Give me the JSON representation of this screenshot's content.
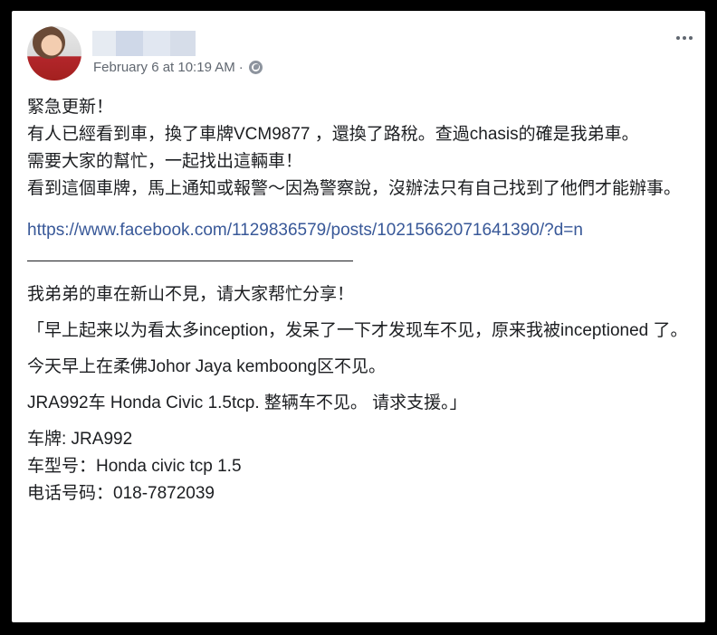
{
  "post": {
    "timestamp": "February 6 at 10:19 AM",
    "separator_dot": "·",
    "audience_icon": "globe-icon",
    "more_icon": "more-options-icon"
  },
  "content": {
    "update_lines": [
      "緊急更新！",
      "有人已經看到車，換了車牌VCM9877 ，還換了路稅。查過chasis的確是我弟車。",
      "需要大家的幫忙，一起找出這輛車！",
      "看到這個車牌，馬上通知或報警～因為警察說，沒辦法只有自己找到了他們才能辦事。"
    ],
    "link": "https://www.facebook.com/1129836579/posts/10215662071641390/?d=n",
    "separator_line": "___________________________________",
    "appeal": "我弟弟的車在新山不見，请大家帮忙分享！",
    "quote_1": "「早上起来以为看太多inception，发呆了一下才发现车不见，原来我被inceptioned 了。",
    "quote_2": "今天早上在柔佛Johor Jaya kemboong区不见。",
    "quote_3": "JRA992车 Honda Civic 1.5tcp. 整辆车不见。 请求支援。」",
    "details": [
      "车牌: JRA992",
      "车型号：Honda civic tcp 1.5",
      "电话号码：018-7872039"
    ]
  },
  "colors": {
    "link": "#385898",
    "meta": "#606770",
    "text": "#1c1e21"
  }
}
